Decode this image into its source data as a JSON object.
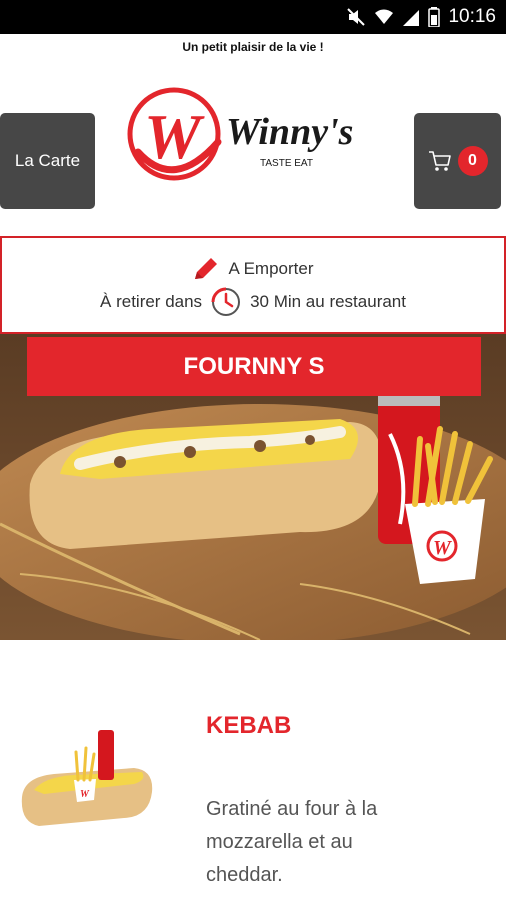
{
  "status_bar": {
    "time": "10:16"
  },
  "header": {
    "tagline": "Un petit plaisir de la vie !",
    "menu_button_label": "La Carte",
    "cart_count": "0",
    "logo": {
      "brand": "Winny's",
      "subtitle": "TASTE EAT"
    }
  },
  "order_info": {
    "mode": "A Emporter",
    "pickup_prefix": "À retirer dans",
    "pickup_suffix": "30 Min au restaurant"
  },
  "hero": {
    "title": "FOURNNY S"
  },
  "product": {
    "name": "KEBAB",
    "description": "Gratiné au four à la mozzarella et au cheddar."
  },
  "colors": {
    "brand_red": "#e3262c",
    "button_gray": "#474747"
  }
}
